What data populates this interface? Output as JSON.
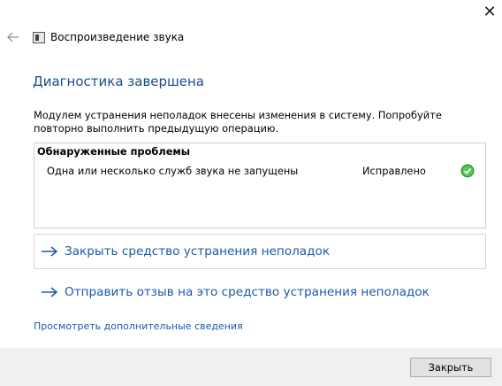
{
  "window": {
    "close_glyph": "✕"
  },
  "header": {
    "title": "Воспроизведение звука"
  },
  "main": {
    "page_title": "Диагностика завершена",
    "description": "Модулем устранения неполадок внесены изменения в систему. Попробуйте повторно выполнить предыдущую операцию.",
    "problems": {
      "heading": "Обнаруженные проблемы",
      "items": [
        {
          "name": "Одна или несколько служб звука не запущены",
          "status": "Исправлено",
          "status_icon": "check-circle-icon"
        }
      ]
    },
    "links": {
      "close_troubleshooter": "Закрыть средство устранения неполадок",
      "send_feedback": "Отправить отзыв на это средство устранения неполадок"
    },
    "more_info_link": "Просмотреть дополнительные сведения"
  },
  "footer": {
    "close_button": "Закрыть"
  },
  "colors": {
    "link_blue": "#1a5aa8",
    "title_blue": "#1a4d8c",
    "success_green": "#2f9e2f",
    "footer_bg": "#f0f0f0"
  }
}
